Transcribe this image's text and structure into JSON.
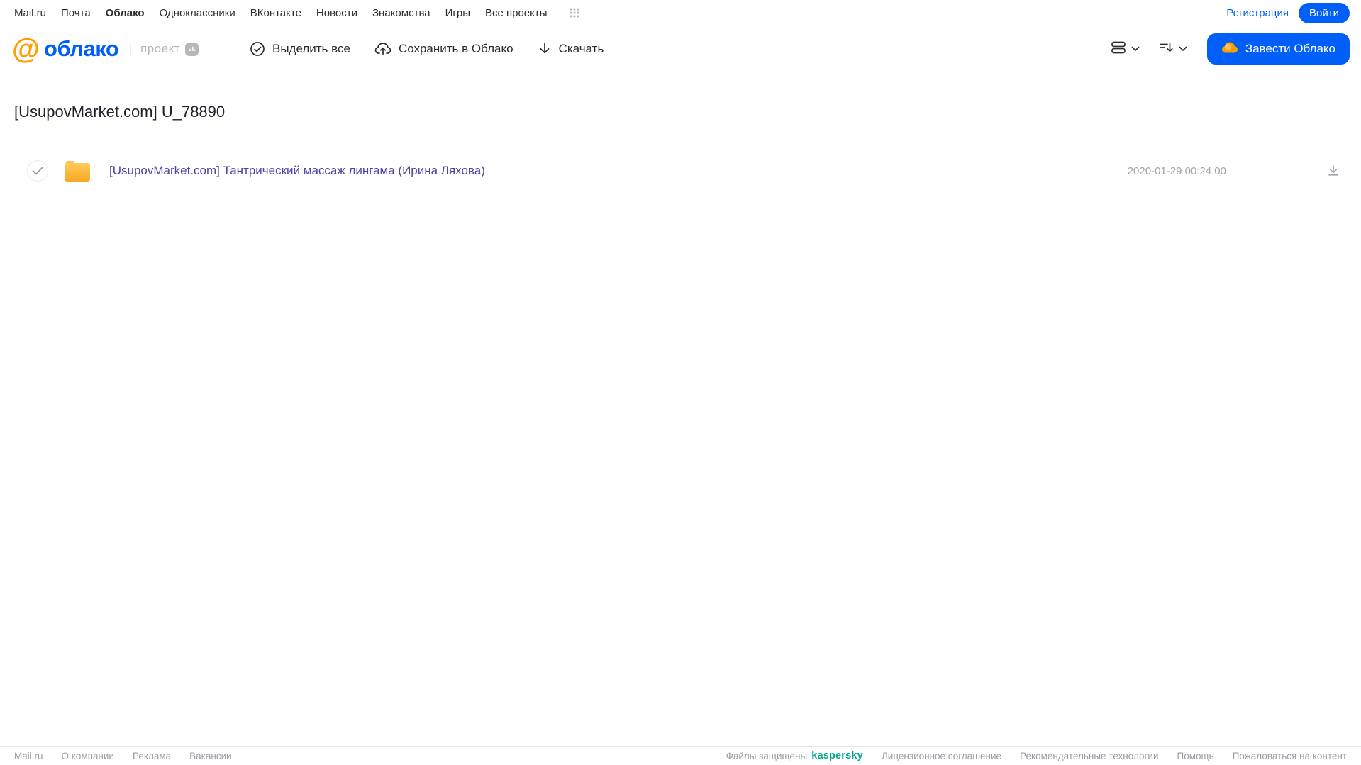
{
  "topnav": {
    "items": [
      {
        "label": "Mail.ru"
      },
      {
        "label": "Почта"
      },
      {
        "label": "Облако"
      },
      {
        "label": "Одноклассники"
      },
      {
        "label": "ВКонтакте"
      },
      {
        "label": "Новости"
      },
      {
        "label": "Знакомства"
      },
      {
        "label": "Игры"
      },
      {
        "label": "Все проекты"
      }
    ],
    "register_label": "Регистрация",
    "login_label": "Войти"
  },
  "header": {
    "logo_at": "@",
    "logo_text": "облако",
    "project_label": "проект",
    "vk_badge": "vk",
    "toolbar": {
      "select_all": "Выделить все",
      "save_to_cloud": "Сохранить в Облако",
      "download": "Скачать"
    },
    "get_cloud_label": "Завести Облако"
  },
  "main": {
    "title": "[UsupovMarket.com] U_78890",
    "files": [
      {
        "name": "[UsupovMarket.com] Тантрический массаж лингама (Ирина Ляхова)",
        "date": "2020-01-29 00:24:00"
      }
    ]
  },
  "footer": {
    "left": [
      "Mail.ru",
      "О компании",
      "Реклама",
      "Вакансии"
    ],
    "protected_label": "Файлы защищены",
    "kaspersky_label": "kaspersky",
    "right": [
      "Лицензионное соглашение",
      "Рекомендательные технологии",
      "Помощь",
      "Пожаловаться на контент"
    ]
  },
  "colors": {
    "primary_blue": "#005ff9",
    "brand_orange": "#ff9e00",
    "kaspersky_green": "#00a88e",
    "folder_top": "#ffcb5c",
    "folder_bottom": "#f7a823",
    "file_link": "#4b45a8",
    "text_dark": "#2c2d2e",
    "muted_gray": "#9a9da6"
  }
}
